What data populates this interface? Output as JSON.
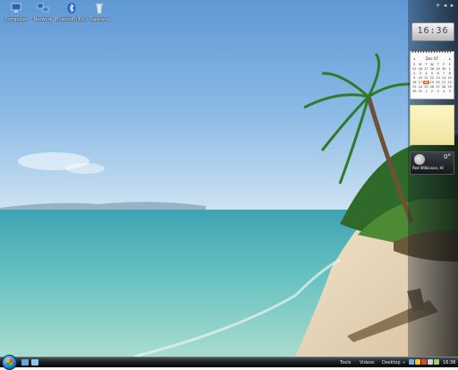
{
  "desktop": {
    "icons": [
      {
        "label": "Computer",
        "icon": "computer-icon"
      },
      {
        "label": "Network",
        "icon": "network-icon"
      },
      {
        "label": "Bluetooth Ex...",
        "icon": "bluetooth-icon"
      },
      {
        "label": "Papelera",
        "icon": "recycle-bin-icon"
      }
    ]
  },
  "sidebar": {
    "controls": [
      {
        "label": "+",
        "icon": "add-gadget-icon"
      },
      {
        "label": "◂",
        "icon": "previous-icon"
      },
      {
        "label": "▸",
        "icon": "next-icon"
      }
    ],
    "clock": {
      "time": "16:36"
    },
    "calendar": {
      "month": "Dec 07",
      "prev": "◂",
      "next": "▸",
      "weekdays": [
        "S",
        "M",
        "T",
        "W",
        "T",
        "F",
        "S"
      ],
      "days": [
        "25",
        "26",
        "27",
        "28",
        "29",
        "30",
        "1",
        "2",
        "3",
        "4",
        "5",
        "6",
        "7",
        "8",
        "9",
        "10",
        "11",
        "12",
        "13",
        "14",
        "15",
        "16",
        "17",
        "18",
        "19",
        "20",
        "21",
        "22",
        "23",
        "24",
        "25",
        "26",
        "27",
        "28",
        "29",
        "30",
        "31",
        "1",
        "2",
        "3",
        "4",
        "5"
      ],
      "today": "18"
    },
    "notes": {
      "text": ""
    },
    "weather": {
      "temp": "0°",
      "location": "Red Wilkinson, HI",
      "icon": "moon-icon"
    }
  },
  "taskbar": {
    "start": {
      "icon": "windows-flag-icon"
    },
    "quick_launch": [
      {
        "icon": "show-desktop-icon",
        "color": "#6aa6d8"
      },
      {
        "icon": "switch-windows-icon",
        "color": "#8cc6f0"
      }
    ],
    "toolbars": [
      "Tools",
      "Videos",
      "Desktop"
    ],
    "chevron": "»",
    "tray_icons": [
      {
        "icon": "network-tray-icon",
        "color": "#6ab0e8"
      },
      {
        "icon": "warning-tray-icon",
        "color": "#f2c230"
      },
      {
        "icon": "security-tray-icon",
        "color": "#d84b2a"
      },
      {
        "icon": "volume-tray-icon",
        "color": "#cfd6de"
      },
      {
        "icon": "battery-tray-icon",
        "color": "#9fd36a"
      }
    ],
    "time": "16:36"
  }
}
